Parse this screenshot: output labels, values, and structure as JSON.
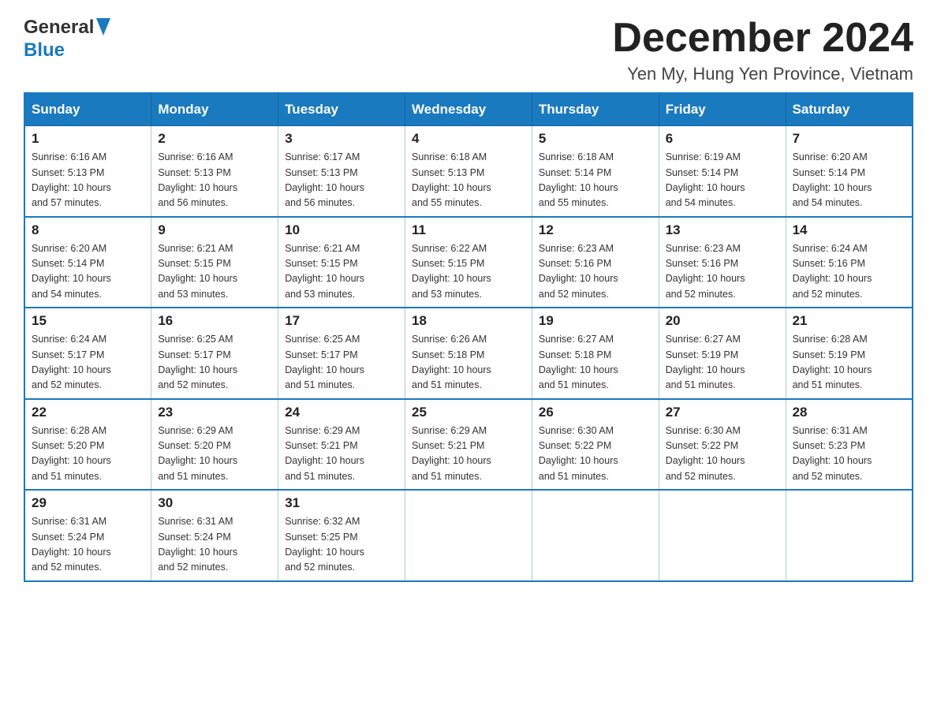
{
  "header": {
    "logo_general": "General",
    "logo_blue": "Blue",
    "month_title": "December 2024",
    "location": "Yen My, Hung Yen Province, Vietnam"
  },
  "days_of_week": [
    "Sunday",
    "Monday",
    "Tuesday",
    "Wednesday",
    "Thursday",
    "Friday",
    "Saturday"
  ],
  "weeks": [
    [
      {
        "day": "1",
        "sunrise": "6:16 AM",
        "sunset": "5:13 PM",
        "daylight": "10 hours and 57 minutes."
      },
      {
        "day": "2",
        "sunrise": "6:16 AM",
        "sunset": "5:13 PM",
        "daylight": "10 hours and 56 minutes."
      },
      {
        "day": "3",
        "sunrise": "6:17 AM",
        "sunset": "5:13 PM",
        "daylight": "10 hours and 56 minutes."
      },
      {
        "day": "4",
        "sunrise": "6:18 AM",
        "sunset": "5:13 PM",
        "daylight": "10 hours and 55 minutes."
      },
      {
        "day": "5",
        "sunrise": "6:18 AM",
        "sunset": "5:14 PM",
        "daylight": "10 hours and 55 minutes."
      },
      {
        "day": "6",
        "sunrise": "6:19 AM",
        "sunset": "5:14 PM",
        "daylight": "10 hours and 54 minutes."
      },
      {
        "day": "7",
        "sunrise": "6:20 AM",
        "sunset": "5:14 PM",
        "daylight": "10 hours and 54 minutes."
      }
    ],
    [
      {
        "day": "8",
        "sunrise": "6:20 AM",
        "sunset": "5:14 PM",
        "daylight": "10 hours and 54 minutes."
      },
      {
        "day": "9",
        "sunrise": "6:21 AM",
        "sunset": "5:15 PM",
        "daylight": "10 hours and 53 minutes."
      },
      {
        "day": "10",
        "sunrise": "6:21 AM",
        "sunset": "5:15 PM",
        "daylight": "10 hours and 53 minutes."
      },
      {
        "day": "11",
        "sunrise": "6:22 AM",
        "sunset": "5:15 PM",
        "daylight": "10 hours and 53 minutes."
      },
      {
        "day": "12",
        "sunrise": "6:23 AM",
        "sunset": "5:16 PM",
        "daylight": "10 hours and 52 minutes."
      },
      {
        "day": "13",
        "sunrise": "6:23 AM",
        "sunset": "5:16 PM",
        "daylight": "10 hours and 52 minutes."
      },
      {
        "day": "14",
        "sunrise": "6:24 AM",
        "sunset": "5:16 PM",
        "daylight": "10 hours and 52 minutes."
      }
    ],
    [
      {
        "day": "15",
        "sunrise": "6:24 AM",
        "sunset": "5:17 PM",
        "daylight": "10 hours and 52 minutes."
      },
      {
        "day": "16",
        "sunrise": "6:25 AM",
        "sunset": "5:17 PM",
        "daylight": "10 hours and 52 minutes."
      },
      {
        "day": "17",
        "sunrise": "6:25 AM",
        "sunset": "5:17 PM",
        "daylight": "10 hours and 51 minutes."
      },
      {
        "day": "18",
        "sunrise": "6:26 AM",
        "sunset": "5:18 PM",
        "daylight": "10 hours and 51 minutes."
      },
      {
        "day": "19",
        "sunrise": "6:27 AM",
        "sunset": "5:18 PM",
        "daylight": "10 hours and 51 minutes."
      },
      {
        "day": "20",
        "sunrise": "6:27 AM",
        "sunset": "5:19 PM",
        "daylight": "10 hours and 51 minutes."
      },
      {
        "day": "21",
        "sunrise": "6:28 AM",
        "sunset": "5:19 PM",
        "daylight": "10 hours and 51 minutes."
      }
    ],
    [
      {
        "day": "22",
        "sunrise": "6:28 AM",
        "sunset": "5:20 PM",
        "daylight": "10 hours and 51 minutes."
      },
      {
        "day": "23",
        "sunrise": "6:29 AM",
        "sunset": "5:20 PM",
        "daylight": "10 hours and 51 minutes."
      },
      {
        "day": "24",
        "sunrise": "6:29 AM",
        "sunset": "5:21 PM",
        "daylight": "10 hours and 51 minutes."
      },
      {
        "day": "25",
        "sunrise": "6:29 AM",
        "sunset": "5:21 PM",
        "daylight": "10 hours and 51 minutes."
      },
      {
        "day": "26",
        "sunrise": "6:30 AM",
        "sunset": "5:22 PM",
        "daylight": "10 hours and 51 minutes."
      },
      {
        "day": "27",
        "sunrise": "6:30 AM",
        "sunset": "5:22 PM",
        "daylight": "10 hours and 52 minutes."
      },
      {
        "day": "28",
        "sunrise": "6:31 AM",
        "sunset": "5:23 PM",
        "daylight": "10 hours and 52 minutes."
      }
    ],
    [
      {
        "day": "29",
        "sunrise": "6:31 AM",
        "sunset": "5:24 PM",
        "daylight": "10 hours and 52 minutes."
      },
      {
        "day": "30",
        "sunrise": "6:31 AM",
        "sunset": "5:24 PM",
        "daylight": "10 hours and 52 minutes."
      },
      {
        "day": "31",
        "sunrise": "6:32 AM",
        "sunset": "5:25 PM",
        "daylight": "10 hours and 52 minutes."
      },
      null,
      null,
      null,
      null
    ]
  ],
  "sunrise_label": "Sunrise:",
  "sunset_label": "Sunset:",
  "daylight_label": "Daylight:"
}
